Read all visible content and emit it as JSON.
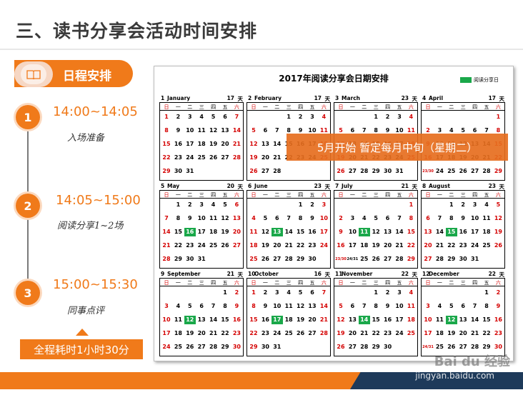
{
  "title": "三、读书分享会活动时间安排",
  "schedule_label": "日程安排",
  "steps": [
    {
      "num": "1",
      "time": "14:00~14:05",
      "desc": "入场准备"
    },
    {
      "num": "2",
      "time": "14:05~15:00",
      "desc": "阅读分享1~2场"
    },
    {
      "num": "3",
      "time": "15:00~15:30",
      "desc": "同事点评"
    }
  ],
  "total": "全程耗时1小时30分",
  "calendar": {
    "title": "2017年阅读分享会日期安排",
    "legend": "阅读分享日",
    "weekdays": [
      "日",
      "一",
      "二",
      "三",
      "四",
      "五",
      "六"
    ],
    "tian": "天",
    "months": [
      {
        "num": "1",
        "name": "January",
        "days": "17",
        "start": 0,
        "len": 31,
        "hl": []
      },
      {
        "num": "2",
        "name": "February",
        "days": "17",
        "start": 3,
        "len": 28,
        "hl": []
      },
      {
        "num": "3",
        "name": "March",
        "days": "23",
        "start": 3,
        "len": 31,
        "hl": []
      },
      {
        "num": "4",
        "name": "April",
        "days": "17",
        "start": 6,
        "len": 30,
        "hl": []
      },
      {
        "num": "5",
        "name": "May",
        "days": "20",
        "start": 1,
        "len": 31,
        "hl": [
          16
        ]
      },
      {
        "num": "6",
        "name": "June",
        "days": "23",
        "start": 4,
        "len": 30,
        "hl": [
          13
        ]
      },
      {
        "num": "7",
        "name": "July",
        "days": "21",
        "start": 6,
        "len": 31,
        "hl": [
          11
        ]
      },
      {
        "num": "8",
        "name": "August",
        "days": "23",
        "start": 2,
        "len": 31,
        "hl": [
          15
        ]
      },
      {
        "num": "9",
        "name": "September",
        "days": "21",
        "start": 5,
        "len": 30,
        "hl": [
          12
        ]
      },
      {
        "num": "10",
        "name": "October",
        "days": "16",
        "start": 0,
        "len": 31,
        "hl": [
          17
        ]
      },
      {
        "num": "11",
        "name": "November",
        "days": "22",
        "start": 3,
        "len": 30,
        "hl": [
          14
        ]
      },
      {
        "num": "12",
        "name": "December",
        "days": "22",
        "start": 5,
        "len": 31,
        "hl": [
          12
        ]
      }
    ]
  },
  "banner": "5月开始  暂定每月中旬（星期二）",
  "watermark": "Bai du 经验",
  "watermark_url": "jingyan.baidu.com"
}
